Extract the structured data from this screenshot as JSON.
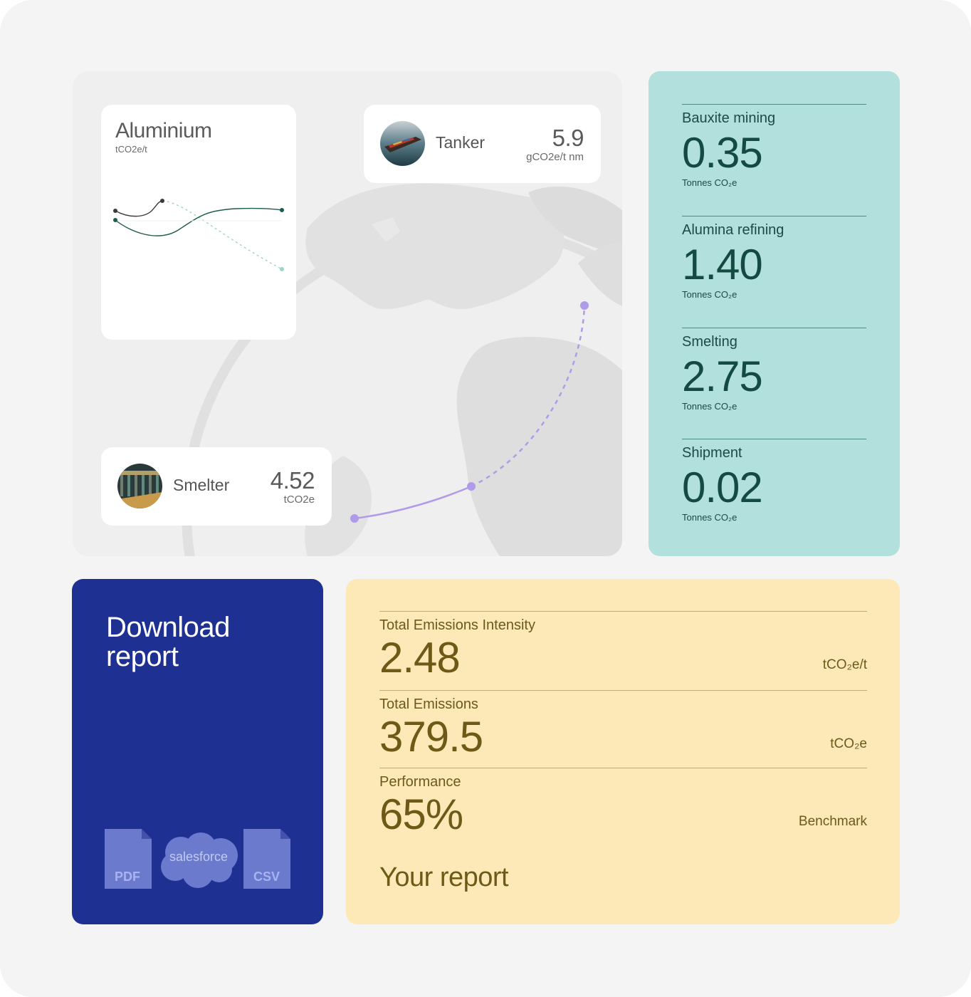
{
  "aluminium": {
    "title": "Aluminium",
    "unit": "tCO2e/t"
  },
  "tanker": {
    "name": "Tanker",
    "value": "5.9",
    "unit": "gCO2e/t nm"
  },
  "smelter": {
    "name": "Smelter",
    "value": "4.52",
    "unit": "tCO2e"
  },
  "stages": [
    {
      "name": "Bauxite mining",
      "value": "0.35",
      "unit": "Tonnes CO₂e"
    },
    {
      "name": "Alumina refining",
      "value": "1.40",
      "unit": "Tonnes CO₂e"
    },
    {
      "name": "Smelting",
      "value": "2.75",
      "unit": "Tonnes CO₂e"
    },
    {
      "name": "Shipment",
      "value": "0.02",
      "unit": "Tonnes CO₂e"
    }
  ],
  "download": {
    "title": "Download report",
    "formats": {
      "pdf": "PDF",
      "salesforce": "salesforce",
      "csv": "CSV"
    }
  },
  "report": {
    "metrics": [
      {
        "label": "Total Emissions Intensity",
        "value": "2.48",
        "unit": "tCO₂e/t"
      },
      {
        "label": "Total Emissions",
        "value": "379.5",
        "unit": "tCO₂e"
      },
      {
        "label": "Performance",
        "value": "65%",
        "unit": "Benchmark"
      }
    ],
    "title": "Your report"
  },
  "colors": {
    "background": "#f4f4f4",
    "process_panel": "#b2e0dc",
    "download_panel": "#1e3192",
    "report_panel": "#fde9b7",
    "route": "#b09be8"
  }
}
